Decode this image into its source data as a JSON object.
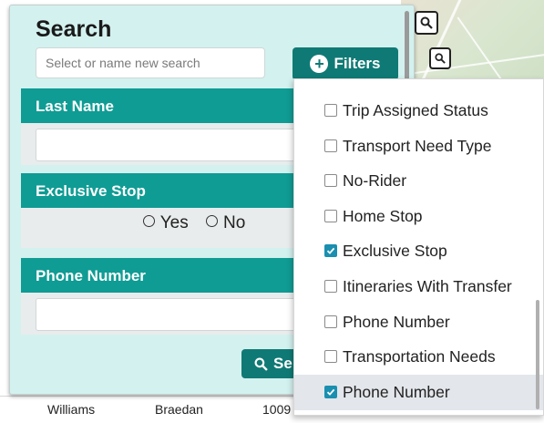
{
  "search_panel": {
    "title": "Search",
    "search_placeholder": "Select or name new search",
    "filters_label": "Filters",
    "search_button_label": "Se"
  },
  "sections": {
    "last_name": {
      "header": "Last Name"
    },
    "exclusive_stop": {
      "header": "Exclusive Stop",
      "option_yes": "Yes",
      "option_no": "No"
    },
    "phone_number": {
      "header": "Phone Number"
    }
  },
  "filter_menu": {
    "items": [
      {
        "label": "Trip Assigned Status",
        "checked": false
      },
      {
        "label": "Transport Need Type",
        "checked": false
      },
      {
        "label": "No-Rider",
        "checked": false
      },
      {
        "label": "Home Stop",
        "checked": false
      },
      {
        "label": "Exclusive Stop",
        "checked": true
      },
      {
        "label": "Itineraries With Transfer",
        "checked": false
      },
      {
        "label": "Phone Number",
        "checked": false
      },
      {
        "label": "Transportation Needs",
        "checked": false
      },
      {
        "label": "Phone Number",
        "checked": true
      }
    ]
  },
  "table_row": {
    "last_name": "Williams",
    "first_name": "Braedan",
    "id": "1009"
  },
  "colors": {
    "teal_header": "#0f9c94",
    "teal_button": "#0f7a75",
    "panel_bg": "#d3f1ef",
    "checkbox_checked": "#1a8fb0"
  }
}
